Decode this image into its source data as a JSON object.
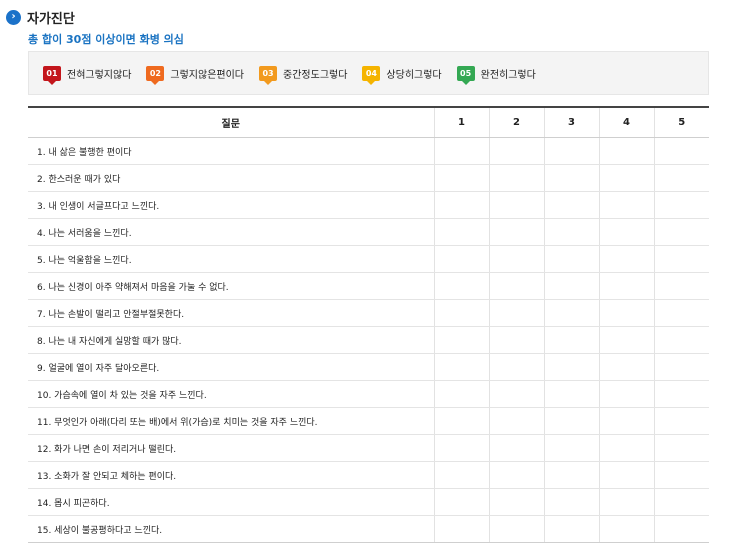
{
  "header": {
    "title": "자가진단",
    "subtitle": "총 합이 30점 이상이면 화병 의심"
  },
  "legend": [
    {
      "num": "01",
      "label": "전혀그렇지않다",
      "color": "#c3161c"
    },
    {
      "num": "02",
      "label": "그렇지않은편이다",
      "color": "#ef6a1f"
    },
    {
      "num": "03",
      "label": "중간정도그렇다",
      "color": "#f29a1e"
    },
    {
      "num": "04",
      "label": "상당히그렇다",
      "color": "#f5b400"
    },
    {
      "num": "05",
      "label": "완전히그렇다",
      "color": "#34a853"
    }
  ],
  "table": {
    "question_header": "질문",
    "score_headers": [
      "1",
      "2",
      "3",
      "4",
      "5"
    ],
    "questions": [
      "1. 내 삶은 불행한 편이다",
      "2. 한스러운 때가 있다",
      "3. 내 인생이 서글프다고 느낀다.",
      "4. 나는 서러움을 느낀다.",
      "5. 나는 억울함을 느낀다.",
      "6. 나는 신경이 아주 약해져서 마음을 가눌 수 없다.",
      "7. 나는 손발이 떨리고 안절부절못한다.",
      "8. 나는 내 자신에게 실망할 때가 많다.",
      "9. 얼굴에 열이 자주 달아오른다.",
      "10. 가슴속에 열이 차 있는 것을 자주 느낀다.",
      "11. 무엇인가 아래(다리 또는 배)에서 위(가슴)로 치미는 것을 자주 느낀다.",
      "12. 화가 나면 손이 저리거나 떨린다.",
      "13. 소화가 잘 안되고 체하는 편이다.",
      "14. 몹시 피곤하다.",
      "15. 세상이 불공평하다고 느낀다."
    ]
  }
}
